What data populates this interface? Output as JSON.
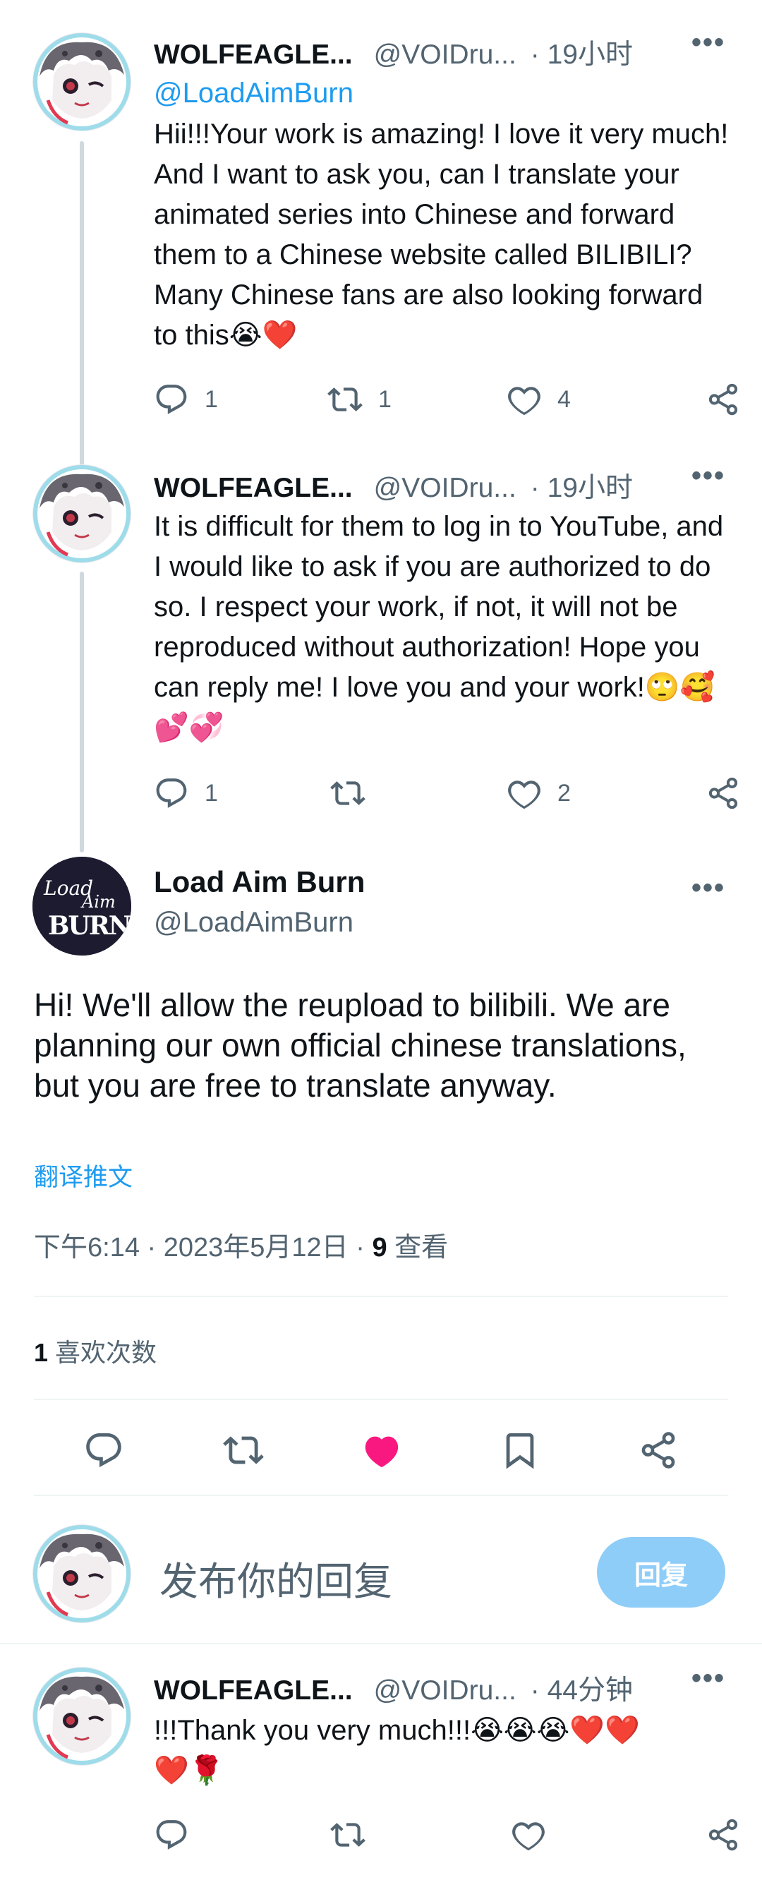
{
  "tweets": [
    {
      "name": "WOLFEAGLE...",
      "handle": "@VOIDru...",
      "time": "· 19小时",
      "reply_to": "@LoadAimBurn",
      "text": "Hii!!!Your work is amazing! I love it very much! And I want to ask you, can I translate your animated series into Chinese and forward them to a Chinese website called BILIBILI? Many Chinese fans are also looking forward to this",
      "emojis": "😭❤️",
      "replies": "1",
      "retweets": "1",
      "likes": "4"
    },
    {
      "name": "WOLFEAGLE...",
      "handle": "@VOIDru...",
      "time": "· 19小时",
      "text": "It is difficult for them to log in to YouTube, and I would like to ask if you are authorized to do so. I respect your work, if not, it will not be reproduced without authorization! Hope you can reply me! I love you and your work!",
      "emojis": "🙄🥰💕💞",
      "replies": "1",
      "retweets": "",
      "likes": "2"
    }
  ],
  "main_tweet": {
    "name": "Load Aim Burn",
    "handle": "@LoadAimBurn",
    "avatar_text_1": "Load",
    "avatar_text_2": "Aim",
    "avatar_text_3": "BURN",
    "text": "Hi! We'll allow the reupload to bilibili.  We are planning our own official chinese translations, but you are free to translate anyway.",
    "translate_link": "翻译推文",
    "timestamp": "下午6:14 · 2023年5月12日 · ",
    "views_count": "9",
    "views_label": " 查看",
    "likes_count": "1",
    "likes_label": " 喜欢次数"
  },
  "compose": {
    "placeholder": "发布你的回复",
    "reply_button": "回复"
  },
  "last_reply": {
    "name": "WOLFEAGLE...",
    "handle": "@VOIDru...",
    "time": "· 44分钟",
    "text": "!!!Thank you very much!!!",
    "emojis_line1": "😭😭😭❤️❤️",
    "emojis_line2": "❤️🌹"
  },
  "icons": {
    "more": "more-dots-icon",
    "reply": "reply-bubble-icon",
    "retweet": "retweet-icon",
    "like": "heart-icon",
    "bookmark": "bookmark-icon",
    "share": "share-icon"
  },
  "colors": {
    "accent": "#1d9bf0",
    "like_active": "#f91880",
    "muted": "#536471",
    "reply_button_bg": "#8ecdf8"
  }
}
